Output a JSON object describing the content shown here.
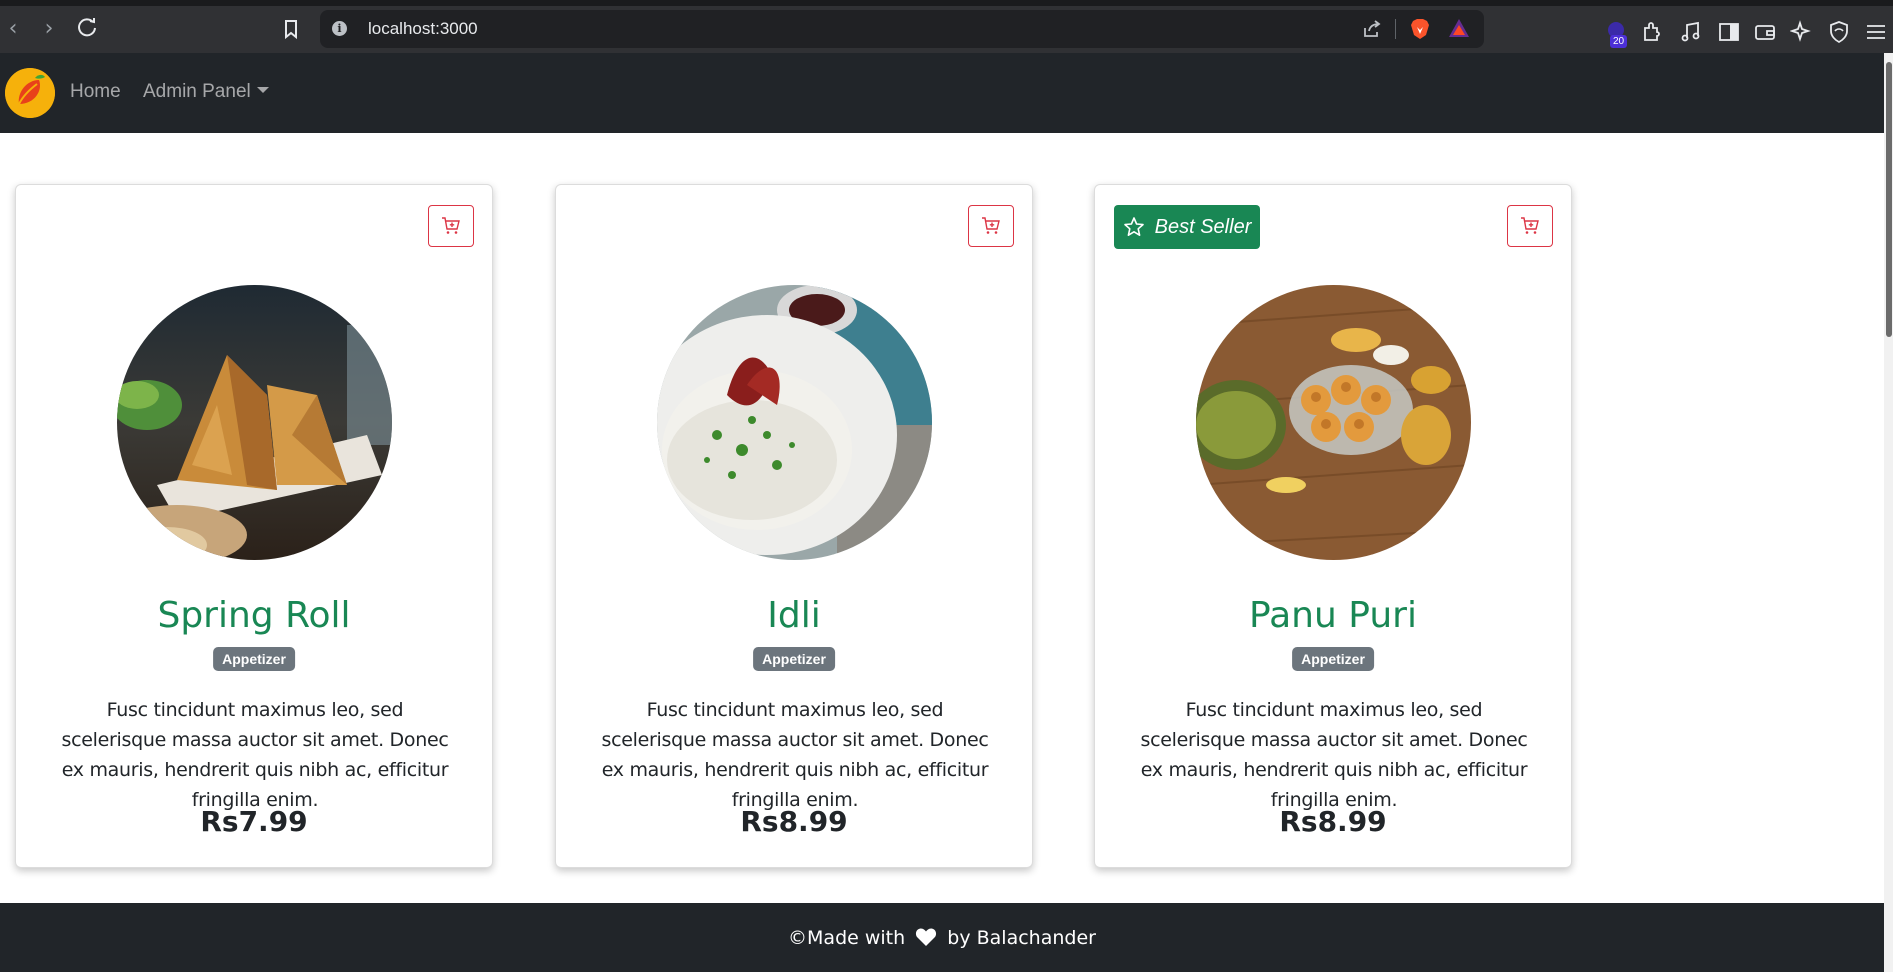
{
  "browser": {
    "url": "localhost:3000",
    "extension_badge_count": "20"
  },
  "navbar": {
    "links": [
      {
        "label": "Home"
      },
      {
        "label": "Admin Panel"
      }
    ]
  },
  "colors": {
    "primary_green": "#198754",
    "danger_red": "#dc3545",
    "secondary_grey": "#6c757d",
    "dark_bg": "#212529"
  },
  "menu": {
    "items": [
      {
        "name": "Spring Roll",
        "category": "Appetizer",
        "description": "Fusc tincidunt maximus leo, sed scelerisque massa auctor sit amet. Donec ex mauris, hendrerit quis nibh ac, efficitur fringilla enim.",
        "price": "Rs7.99",
        "best_seller": false
      },
      {
        "name": "Idli",
        "category": "Appetizer",
        "description": "Fusc tincidunt maximus leo, sed scelerisque massa auctor sit amet. Donec ex mauris, hendrerit quis nibh ac, efficitur fringilla enim.",
        "price": "Rs8.99",
        "best_seller": false
      },
      {
        "name": "Panu Puri",
        "category": "Appetizer",
        "description": "Fusc tincidunt maximus leo, sed scelerisque massa auctor sit amet. Donec ex mauris, hendrerit quis nibh ac, efficitur fringilla enim.",
        "price": "Rs8.99",
        "best_seller": true,
        "badge_label": "Best Seller"
      }
    ]
  },
  "footer": {
    "prefix": "©Made with",
    "suffix": "by Balachander"
  }
}
